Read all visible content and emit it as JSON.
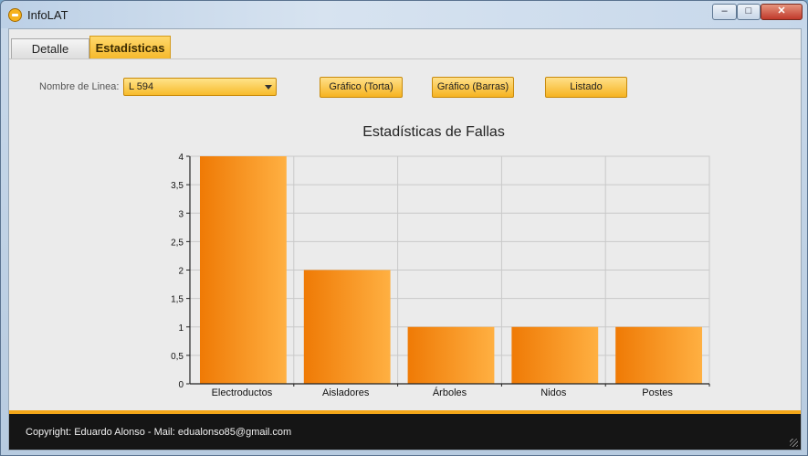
{
  "window": {
    "title": "InfoLAT"
  },
  "tabs": [
    {
      "label": "Detalle"
    },
    {
      "label": "Estadísticas"
    }
  ],
  "filters": {
    "line_label": "Nombre de Linea:",
    "line_value": "L 594"
  },
  "buttons": {
    "pie_label": "Gráfico (Torta)",
    "bars_label": "Gráfico (Barras)",
    "list_label": "Listado"
  },
  "chart_data": {
    "type": "bar",
    "title": "Estadísticas de Fallas",
    "categories": [
      "Electroductos",
      "Aisladores",
      "Árboles",
      "Nidos",
      "Postes"
    ],
    "values": [
      4,
      2,
      1,
      1,
      1
    ],
    "ylim": [
      0,
      4
    ],
    "yticks": [
      "0",
      "0,5",
      "1",
      "1,5",
      "2",
      "2,5",
      "3",
      "3,5",
      "4"
    ],
    "grid": true,
    "colors": {
      "bar_start": "#ef7a05",
      "bar_end": "#ffb042"
    }
  },
  "footer": {
    "copyright": "Copyright: Eduardo Alonso - Mail: edualonso85@gmail.com"
  }
}
